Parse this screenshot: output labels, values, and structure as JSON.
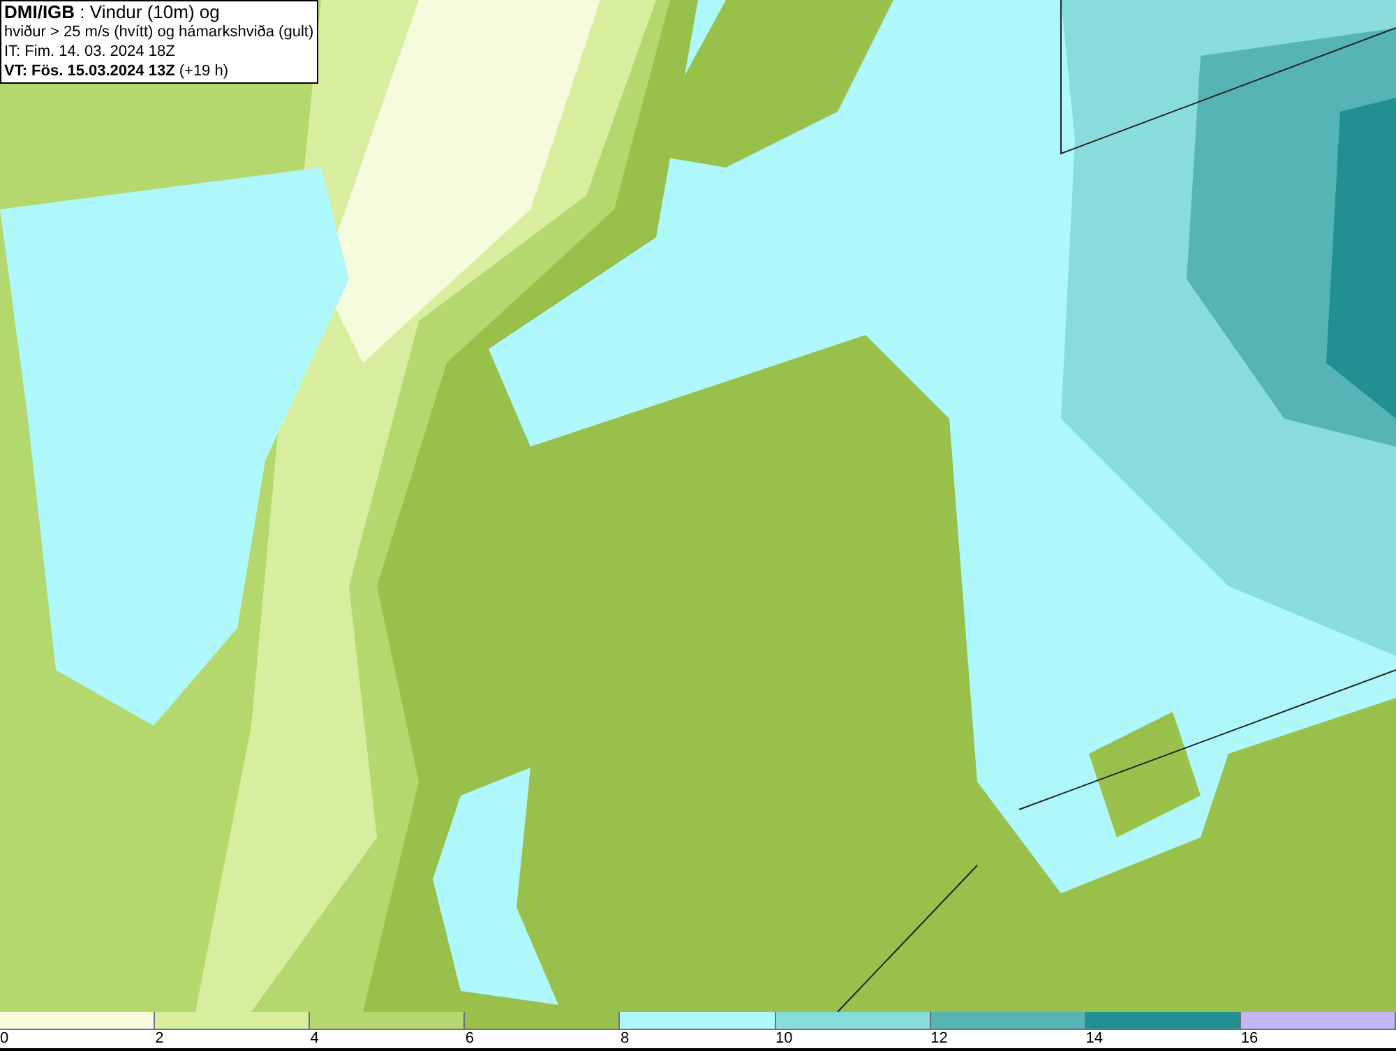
{
  "info_box": {
    "lines": [
      "**DMI/IGB** : Vindur (10m) og",
      "hviður > 25 m/s (hvítt) og hámarkshviða (gult)",
      "IT: Fim. 14. 03. 2024 18Z",
      "**VT: Fös. 15.03.2024 13Z** (+19 h)"
    ]
  },
  "legend": {
    "segments": [
      {
        "color": "#f5fbdc"
      },
      {
        "color": "#d8ee9e"
      },
      {
        "color": "#b5d86e"
      },
      {
        "color": "#98c04a"
      },
      {
        "color": "#aef8fc"
      },
      {
        "color": "#88dcdc"
      },
      {
        "color": "#56b4b4"
      },
      {
        "color": "#229090"
      },
      {
        "color": "#c4b4f8"
      }
    ],
    "ticks": [
      "0",
      "2",
      "4",
      "6",
      "8",
      "10",
      "12",
      "14",
      "16"
    ]
  }
}
